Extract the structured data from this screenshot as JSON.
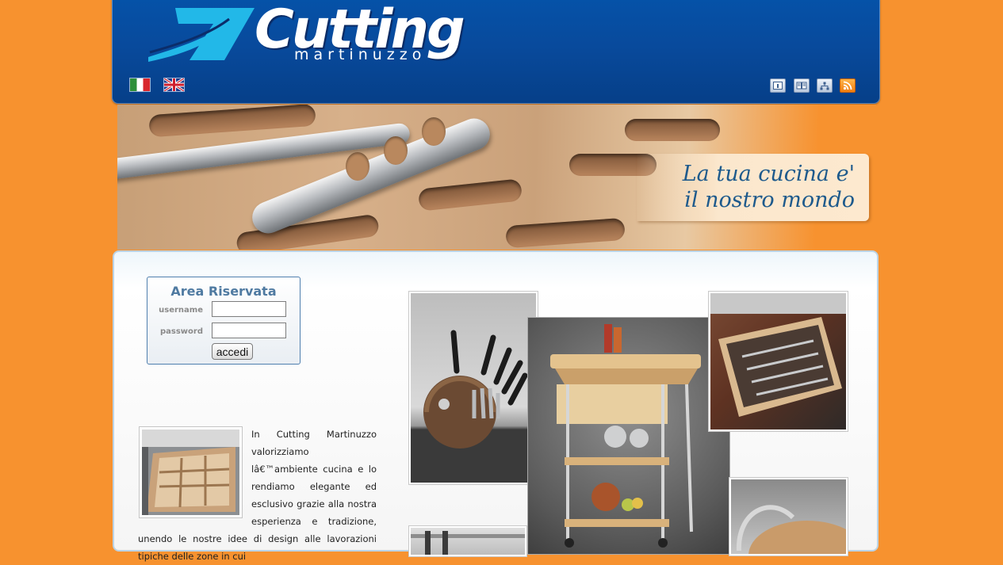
{
  "header": {
    "logo_word": "Cutting",
    "logo_sub": "martinuzzo",
    "languages": [
      "italiano",
      "english"
    ],
    "tools": [
      "home-icon",
      "catalog-icon",
      "sitemap-icon",
      "rss-icon"
    ]
  },
  "banner": {
    "slogan_line1": "La tua cucina e'",
    "slogan_line2": "il nostro mondo"
  },
  "login": {
    "title": "Area Riservata",
    "username_label": "username",
    "password_label": "password",
    "username_value": "",
    "password_value": "",
    "submit_label": "accedi"
  },
  "intro": {
    "text": "In Cutting Martinuzzo valorizziamo lâ€™ambiente cucina e lo rendiamo elegante ed esclusivo grazie alla nostra esperienza e tradizione, unendo le nostre idee di design alle lavorazioni tipiche delle zone in cui"
  },
  "colors": {
    "background": "#f7922f",
    "header_blue": "#084a9c",
    "slogan_blue": "#1e5a8c",
    "login_title": "#4f7aa1"
  }
}
